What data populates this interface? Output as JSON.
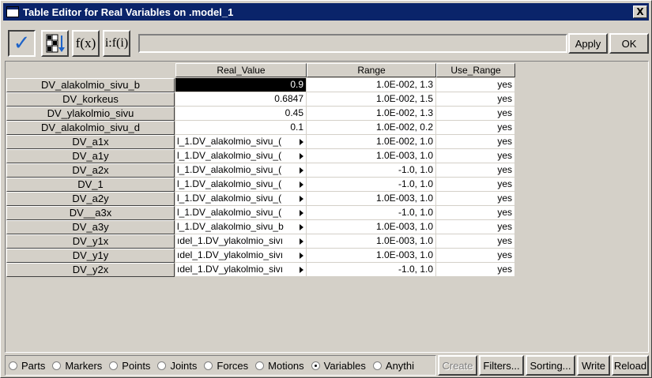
{
  "window": {
    "title": "Table Editor for Real Variables on .model_1",
    "close_label": "X"
  },
  "toolbar": {
    "check_icon": "✓",
    "fx_label": "f(x)",
    "ifi_label": "i:f(i)",
    "entry_value": "",
    "apply_label": "Apply",
    "ok_label": "OK"
  },
  "table": {
    "columns": [
      "Real_Value",
      "Range",
      "Use_Range"
    ],
    "rows": [
      {
        "name": "DV_alakolmio_sivu_b",
        "real_value": "0.9",
        "range": "1.0E-002, 1.3",
        "use_range": "yes",
        "selected": true,
        "expr": false
      },
      {
        "name": "DV_korkeus",
        "real_value": "0.6847",
        "range": "1.0E-002, 1.5",
        "use_range": "yes",
        "selected": false,
        "expr": false
      },
      {
        "name": "DV_ylakolmio_sivu",
        "real_value": "0.45",
        "range": "1.0E-002, 1.3",
        "use_range": "yes",
        "selected": false,
        "expr": false
      },
      {
        "name": "DV_alakolmio_sivu_d",
        "real_value": "0.1",
        "range": "1.0E-002, 0.2",
        "use_range": "yes",
        "selected": false,
        "expr": false
      },
      {
        "name": "DV_a1x",
        "real_value": "l_1.DV_alakolmio_sivu_(",
        "range": "1.0E-002, 1.0",
        "use_range": "yes",
        "selected": false,
        "expr": true
      },
      {
        "name": "DV_a1y",
        "real_value": "l_1.DV_alakolmio_sivu_(",
        "range": "1.0E-003, 1.0",
        "use_range": "yes",
        "selected": false,
        "expr": true
      },
      {
        "name": "DV_a2x",
        "real_value": "l_1.DV_alakolmio_sivu_(",
        "range": "-1.0, 1.0",
        "use_range": "yes",
        "selected": false,
        "expr": true
      },
      {
        "name": "DV_1",
        "real_value": "l_1.DV_alakolmio_sivu_(",
        "range": "-1.0, 1.0",
        "use_range": "yes",
        "selected": false,
        "expr": true
      },
      {
        "name": "DV_a2y",
        "real_value": "l_1.DV_alakolmio_sivu_(",
        "range": "1.0E-003, 1.0",
        "use_range": "yes",
        "selected": false,
        "expr": true
      },
      {
        "name": "DV__a3x",
        "real_value": "l_1.DV_alakolmio_sivu_(",
        "range": "-1.0, 1.0",
        "use_range": "yes",
        "selected": false,
        "expr": true
      },
      {
        "name": "DV_a3y",
        "real_value": "l_1.DV_alakolmio_sivu_b",
        "range": "1.0E-003, 1.0",
        "use_range": "yes",
        "selected": false,
        "expr": true
      },
      {
        "name": "DV_y1x",
        "real_value": "ıdel_1.DV_ylakolmio_sivı",
        "range": "1.0E-003, 1.0",
        "use_range": "yes",
        "selected": false,
        "expr": true
      },
      {
        "name": "DV_y1y",
        "real_value": "ıdel_1.DV_ylakolmio_sivı",
        "range": "1.0E-003, 1.0",
        "use_range": "yes",
        "selected": false,
        "expr": true
      },
      {
        "name": "DV_y2x",
        "real_value": "ıdel_1.DV_ylakolmio_sivı",
        "range": "-1.0, 1.0",
        "use_range": "yes",
        "selected": false,
        "expr": true
      }
    ]
  },
  "filter": {
    "options": [
      "Parts",
      "Markers",
      "Points",
      "Joints",
      "Forces",
      "Motions",
      "Variables",
      "Anythi"
    ],
    "selected": "Variables"
  },
  "buttons": {
    "create_label": "Create",
    "filters_label": "Filters...",
    "sorting_label": "Sorting...",
    "write_label": "Write",
    "reload_label": "Reload"
  }
}
